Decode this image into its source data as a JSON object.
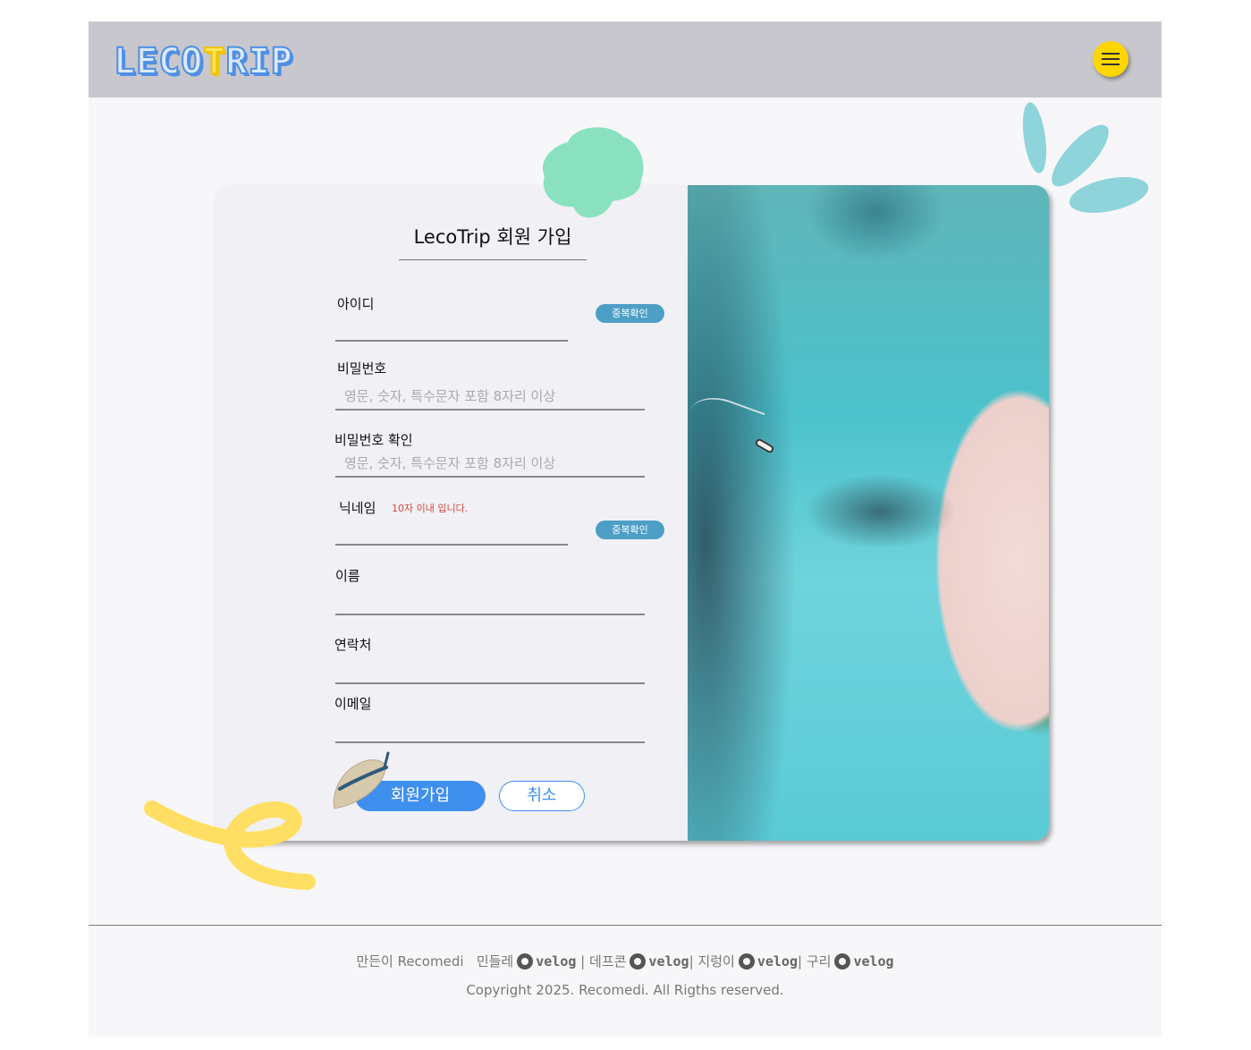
{
  "header": {
    "logo_main": "LECO",
    "logo_accent": "T",
    "logo_tail": "RIP",
    "menu_icon": "hamburger-icon",
    "menu_color": "#ffd600"
  },
  "form": {
    "title": "LecoTrip 회원 가입",
    "fields": {
      "id": {
        "label": "아이디",
        "placeholder": "",
        "dup_label": "중복확인"
      },
      "password": {
        "label": "비밀번호",
        "placeholder": "영문, 숫자, 특수문자 포함 8자리 이상"
      },
      "password_confirm": {
        "label": "비밀번호 확인",
        "placeholder": "영문, 숫자, 특수문자 포함 8자리 이상"
      },
      "nickname": {
        "label": "닉네임",
        "hint": "10자 이내 입니다.",
        "dup_label": "중복확인"
      },
      "name": {
        "label": "이름",
        "placeholder": ""
      },
      "phone": {
        "label": "연락처",
        "placeholder": ""
      },
      "email": {
        "label": "이메일",
        "placeholder": ""
      }
    },
    "submit_label": "회원가입",
    "cancel_label": "취소",
    "accent_color": "#3f8fee"
  },
  "footer": {
    "made_by": "만든이 Recomedi",
    "members": [
      {
        "name": "민들레",
        "link": "velog",
        "sep": "|"
      },
      {
        "name": "데프콘",
        "link": "velog",
        "sep": "|"
      },
      {
        "name": "지렁이",
        "link": "velog",
        "sep": "|"
      },
      {
        "name": "구리",
        "link": "velog",
        "sep": ""
      }
    ],
    "copyright": "Copyright 2025. Recomedi. All Rigths reserved."
  }
}
